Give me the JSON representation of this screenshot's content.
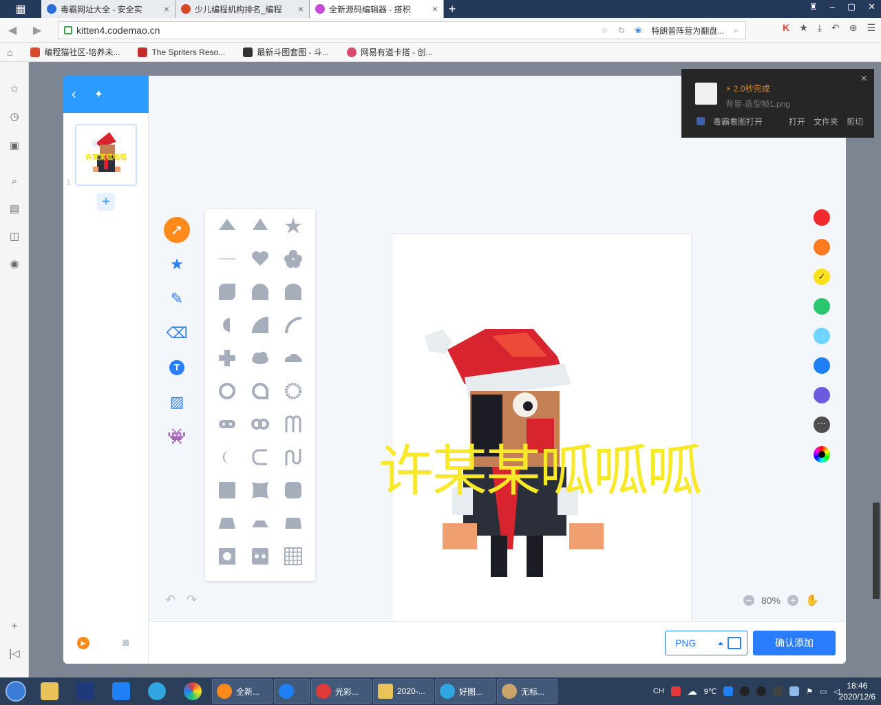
{
  "tabs": [
    {
      "title": "毒霸网址大全 - 安全实",
      "color": "#2a6fd6"
    },
    {
      "title": "少儿编程机构排名_编程",
      "color": "#d9482b"
    },
    {
      "title": "全新源码编辑器 - 搭积",
      "color": "#c64bd6",
      "active": true
    }
  ],
  "address": {
    "url": "kitten4.codemao.cn",
    "search_text": "特朗普阵营为翻盘..."
  },
  "bookmarks": [
    {
      "label": "编程猫社区-培养未...",
      "color": "#d9482b"
    },
    {
      "label": "The Spriters Reso...",
      "color": "#c22b2b"
    },
    {
      "label": "最新斗图套图 - 斗...",
      "color": "#333333"
    },
    {
      "label": "网易有道卡搭 - 创...",
      "color": "#d94b6b"
    }
  ],
  "editor": {
    "frame_index": "1",
    "thumb_text": "许某某呱呱呱",
    "canvas_text": "许某某呱呱呱",
    "zoom": "80%",
    "format": "PNG",
    "confirm_label": "确认添加",
    "palette": [
      "#f02a2a",
      "#ff7a1f",
      "#ffe01f",
      "#28c76f",
      "#6fd4ff",
      "#1f80f5",
      "#6b5be0",
      "#4d4d4d",
      "#rainbow"
    ],
    "selected_color": "#ffe01f"
  },
  "download_popup": {
    "status": "⚡ 2.0秒完成",
    "filename": "背景-造型帧1.png",
    "viewer_label": "毒霸看图打开",
    "actions": [
      "打开",
      "文件夹",
      "剪切"
    ]
  },
  "taskbar": {
    "tasks": [
      {
        "label": "全新...",
        "color": "#ff8a1c"
      },
      {
        "label": "",
        "color": "#1f80f5"
      },
      {
        "label": "光彩...",
        "color": "#e03a3a"
      },
      {
        "label": "2020-...",
        "color": "#e8c35a"
      },
      {
        "label": "好图...",
        "color": "#2fa6e0"
      },
      {
        "label": "无标...",
        "color": "#c9a36b"
      }
    ],
    "weather": "9℃",
    "ime": "CH",
    "time": "18:46",
    "date": "2020/12/6"
  }
}
